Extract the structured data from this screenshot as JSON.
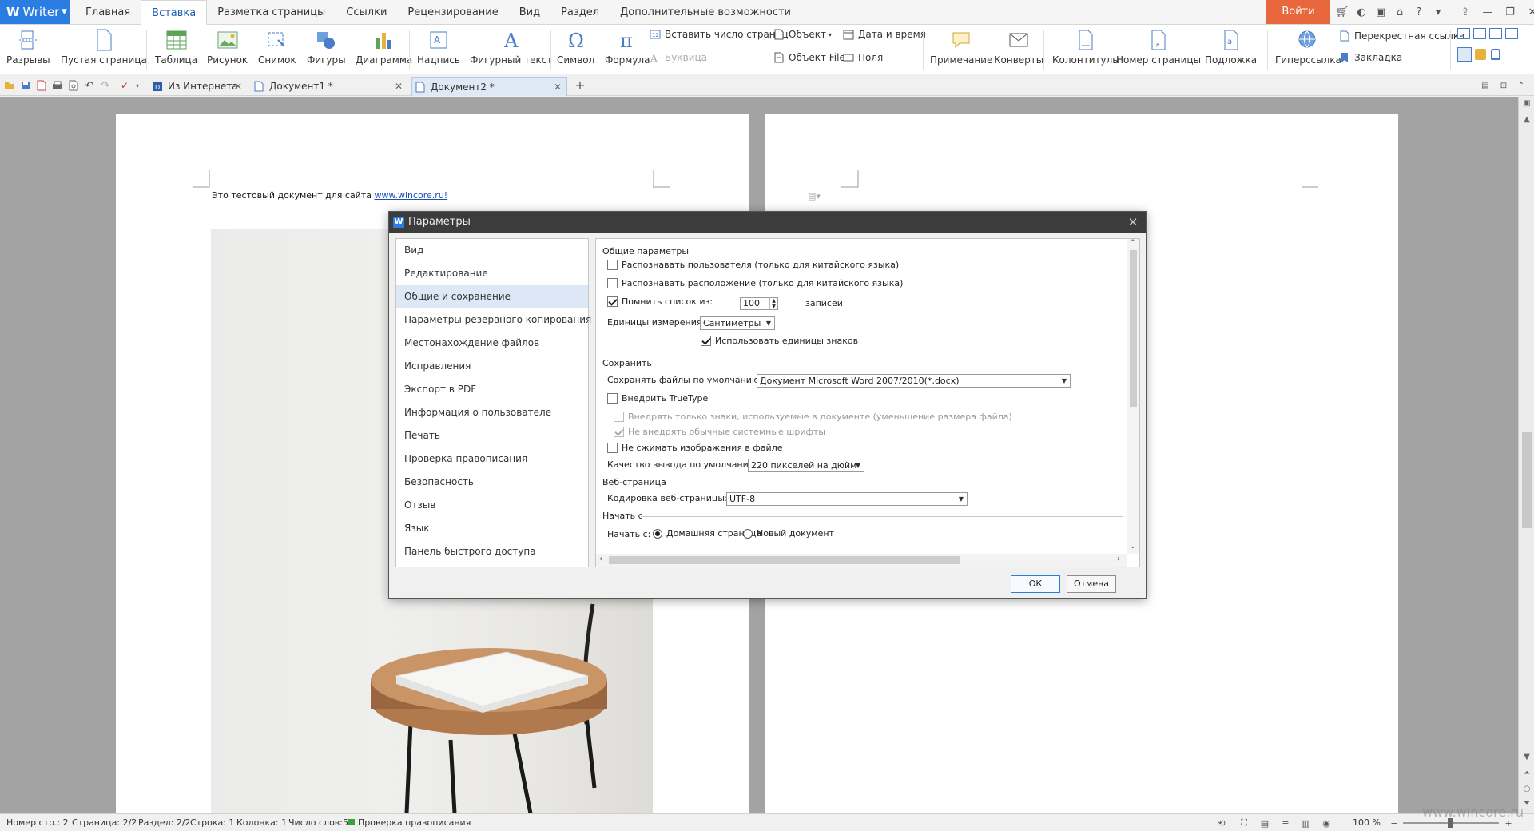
{
  "app": {
    "name": "Writer"
  },
  "menu": {
    "tabs": [
      "Главная",
      "Вставка",
      "Разметка страницы",
      "Ссылки",
      "Рецензирование",
      "Вид",
      "Раздел",
      "Дополнительные возможности"
    ],
    "active_index": 1,
    "login": "Войти"
  },
  "ribbon": {
    "breaks": "Разрывы",
    "blank_page": "Пустая страница",
    "table": "Таблица",
    "picture": "Рисунок",
    "screenshot": "Снимок",
    "shapes": "Фигуры",
    "chart": "Диаграмма",
    "textbox": "Надпись",
    "wordart": "Фигурный текст",
    "symbol": "Символ",
    "formula": "Формула",
    "insert_page_count": "Вставить число страниц",
    "dropcap": "Буквица",
    "object": "Объект",
    "object_file": "Объект File",
    "datetime": "Дата и время",
    "field": "Поля",
    "comment": "Примечание",
    "envelopes": "Конверты",
    "header_footer": "Колонтитулы",
    "page_number": "Номер страницы",
    "watermark": "Подложка",
    "hyperlink": "Гиперссылка",
    "cross_ref": "Перекрестная ссылка",
    "bookmark": "Закладка"
  },
  "doc_tabs": [
    "Из Интернета",
    "Документ1 *",
    "Документ2 *"
  ],
  "document": {
    "text": "Это тестовый документ для сайта ",
    "link": "www.wincore.ru!"
  },
  "dialog": {
    "title": "Параметры",
    "nav": [
      "Вид",
      "Редактирование",
      "Общие и сохранение",
      "Параметры резервного копирования",
      "Местонахождение файлов",
      "Исправления",
      "Экспорт в PDF",
      "Информация о пользователе",
      "Печать",
      "Проверка правописания",
      "Безопасность",
      "Отзыв",
      "Язык",
      "Панель быстрого доступа"
    ],
    "nav_selected": 2,
    "general": {
      "heading": "Общие параметры",
      "recognize_user": "Распознавать пользователя (только для китайского языка)",
      "recognize_location": "Распознавать расположение (только для китайского языка)",
      "remember_list": "Помнить список из:",
      "remember_count": "100",
      "records": "записей",
      "units_label": "Единицы измерения:",
      "units_value": "Сантиметры",
      "char_units": "Использовать единицы знаков"
    },
    "save": {
      "heading": "Сохранить",
      "default_format_label": "Сохранять файлы по умолчанию:",
      "default_format_value": "Документ Microsoft Word 2007/2010(*.docx)",
      "embed_truetype": "Внедрить TrueType",
      "embed_used_only": "Внедрять только знаки, используемые в документе (уменьшение размера файла)",
      "no_system_fonts": "Не внедрять обычные системные шрифты",
      "no_compress_images": "Не сжимать изображения в файле",
      "quality_label": "Качество вывода по умолчанию:",
      "quality_value": "220 пикселей на дюйм"
    },
    "web": {
      "heading": "Веб-страница",
      "encoding_label": "Кодировка веб-страницы:",
      "encoding_value": "UTF-8"
    },
    "start": {
      "heading": "Начать с",
      "label": "Начать с:",
      "home": "Домашняя страница",
      "new_doc": "Новый документ"
    },
    "ok": "ОК",
    "cancel": "Отмена"
  },
  "status": {
    "page_num": "Номер стр.: 2",
    "page": "Страница: 2/2",
    "section": "Раздел: 2/2",
    "line": "Строка: 1",
    "column": "Колонка: 1",
    "words": "Число слов:5",
    "spellcheck": "Проверка правописания",
    "zoom": "100 %",
    "watermark": "www.wincore.ru"
  },
  "colors": {
    "accent": "#2a7de1",
    "login": "#e8673c",
    "workspace": "#a3a3a3"
  }
}
